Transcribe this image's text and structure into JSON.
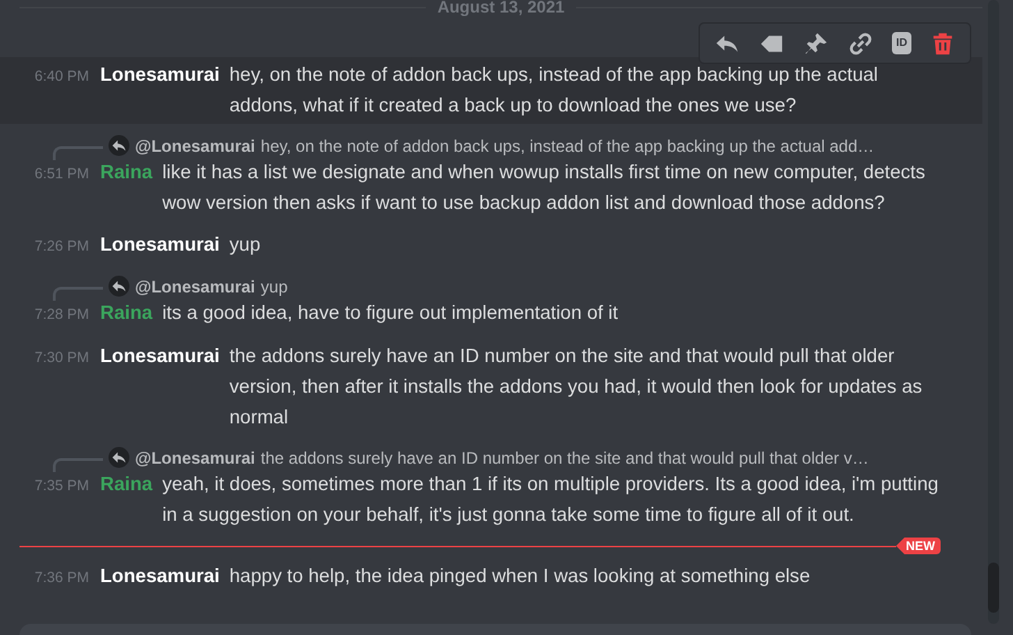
{
  "date_divider": "August 13, 2021",
  "toolbar": [
    {
      "kind": "reply"
    },
    {
      "kind": "tag"
    },
    {
      "kind": "pin"
    },
    {
      "kind": "link"
    },
    {
      "kind": "id",
      "label": "ID"
    },
    {
      "kind": "delete"
    }
  ],
  "messages": [
    {
      "time": "6:40 PM",
      "author": "Lonesamurai",
      "color": "#ffffff",
      "text": "hey, on the note of addon back ups, instead of the app backing up the actual addons, what if it created a back up to download the ones we use?",
      "hovered": true
    },
    {
      "reply": {
        "author": "@Lonesamurai",
        "text": "hey, on the note of addon back ups, instead of the app backing up the actual add…"
      },
      "time": "6:51 PM",
      "author": "Raina",
      "color": "#3ba55d",
      "text": "like it has a list we designate and when wowup installs first time on new computer, detects wow version then asks if want to use backup addon list and download those addons?",
      "hovered": false
    },
    {
      "time": "7:26 PM",
      "author": "Lonesamurai",
      "color": "#ffffff",
      "text": "yup",
      "hovered": false
    },
    {
      "reply": {
        "author": "@Lonesamurai",
        "text": "yup"
      },
      "time": "7:28 PM",
      "author": "Raina",
      "color": "#3ba55d",
      "text": "its a good idea, have to figure out implementation of it",
      "hovered": false
    },
    {
      "time": "7:30 PM",
      "author": "Lonesamurai",
      "color": "#ffffff",
      "text": "the addons surely have an ID number on the site and that would pull that older version, then after it installs the addons you had, it would then look for updates as normal",
      "hovered": false
    },
    {
      "reply": {
        "author": "@Lonesamurai",
        "text": "the addons surely have an ID number on the site and that would pull that older v…"
      },
      "time": "7:35 PM",
      "author": "Raina",
      "color": "#3ba55d",
      "text": "yeah, it does, sometimes more than 1 if its on multiple providers. Its a good idea, i'm putting in a suggestion on your behalf, it's just gonna take some time to figure all of it out.",
      "hovered": false
    },
    {
      "new_divider": "NEW",
      "time": "7:36 PM",
      "author": "Lonesamurai",
      "color": "#ffffff",
      "text": "happy to help, the idea pinged when I was looking at something else",
      "hovered": false
    }
  ]
}
